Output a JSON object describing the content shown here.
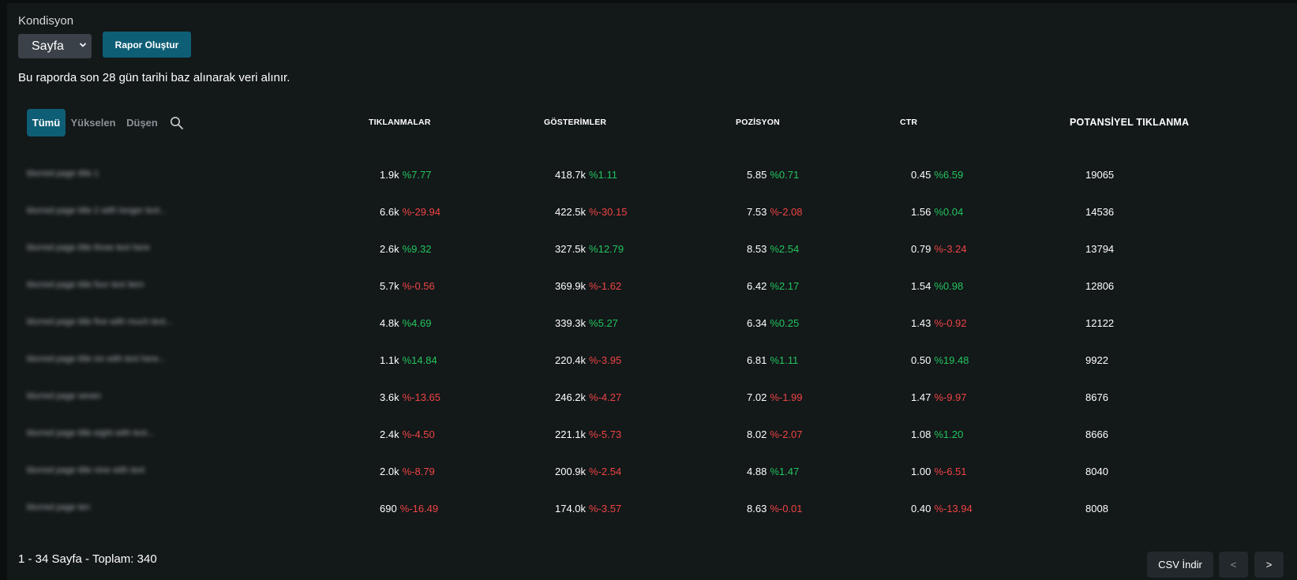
{
  "filter": {
    "label": "Kondisyon",
    "select_value": "Sayfa",
    "report_button": "Rapor Oluştur"
  },
  "info_text": "Bu raporda son 28 gün tarihi baz alınarak veri alınır.",
  "tabs": [
    {
      "label": "Tümü",
      "active": true
    },
    {
      "label": "Yükselen",
      "active": false
    },
    {
      "label": "Düşen",
      "active": false
    }
  ],
  "columns": {
    "clicks": "TIKLANMALAR",
    "impressions": "GÖSTERİMLER",
    "position": "POZİSYON",
    "ctr": "CTR",
    "potential": "POTANSİYEL TIKLANMA"
  },
  "rows": [
    {
      "label": "blurred page title 1",
      "clicks": "1.9k",
      "clicks_delta": "%7.77",
      "clicks_trend": "up",
      "impressions": "418.7k",
      "impressions_delta": "%1.11",
      "impressions_trend": "up",
      "position": "5.85",
      "position_delta": "%0.71",
      "position_trend": "up",
      "ctr": "0.45",
      "ctr_delta": "%6.59",
      "ctr_trend": "up",
      "potential": "19065"
    },
    {
      "label": "blurred page title 2 with longer text...",
      "clicks": "6.6k",
      "clicks_delta": "%-29.94",
      "clicks_trend": "down",
      "impressions": "422.5k",
      "impressions_delta": "%-30.15",
      "impressions_trend": "down",
      "position": "7.53",
      "position_delta": "%-2.08",
      "position_trend": "down",
      "ctr": "1.56",
      "ctr_delta": "%0.04",
      "ctr_trend": "up",
      "potential": "14536"
    },
    {
      "label": "blurred page title three text here",
      "clicks": "2.6k",
      "clicks_delta": "%9.32",
      "clicks_trend": "up",
      "impressions": "327.5k",
      "impressions_delta": "%12.79",
      "impressions_trend": "up",
      "position": "8.53",
      "position_delta": "%2.54",
      "position_trend": "up",
      "ctr": "0.79",
      "ctr_delta": "%-3.24",
      "ctr_trend": "down",
      "potential": "13794"
    },
    {
      "label": "blurred page title four text item",
      "clicks": "5.7k",
      "clicks_delta": "%-0.56",
      "clicks_trend": "down",
      "impressions": "369.9k",
      "impressions_delta": "%-1.62",
      "impressions_trend": "down",
      "position": "6.42",
      "position_delta": "%2.17",
      "position_trend": "up",
      "ctr": "1.54",
      "ctr_delta": "%0.98",
      "ctr_trend": "up",
      "potential": "12806"
    },
    {
      "label": "blurred page title five with much text...",
      "clicks": "4.8k",
      "clicks_delta": "%4.69",
      "clicks_trend": "up",
      "impressions": "339.3k",
      "impressions_delta": "%5.27",
      "impressions_trend": "up",
      "position": "6.34",
      "position_delta": "%0.25",
      "position_trend": "up",
      "ctr": "1.43",
      "ctr_delta": "%-0.92",
      "ctr_trend": "down",
      "potential": "12122"
    },
    {
      "label": "blurred page title six with text here...",
      "clicks": "1.1k",
      "clicks_delta": "%14.84",
      "clicks_trend": "up",
      "impressions": "220.4k",
      "impressions_delta": "%-3.95",
      "impressions_trend": "down",
      "position": "6.81",
      "position_delta": "%1.11",
      "position_trend": "up",
      "ctr": "0.50",
      "ctr_delta": "%19.48",
      "ctr_trend": "up",
      "potential": "9922"
    },
    {
      "label": "blurred page seven",
      "clicks": "3.6k",
      "clicks_delta": "%-13.65",
      "clicks_trend": "down",
      "impressions": "246.2k",
      "impressions_delta": "%-4.27",
      "impressions_trend": "down",
      "position": "7.02",
      "position_delta": "%-1.99",
      "position_trend": "down",
      "ctr": "1.47",
      "ctr_delta": "%-9.97",
      "ctr_trend": "down",
      "potential": "8676"
    },
    {
      "label": "blurred page title eight with text...",
      "clicks": "2.4k",
      "clicks_delta": "%-4.50",
      "clicks_trend": "down",
      "impressions": "221.1k",
      "impressions_delta": "%-5.73",
      "impressions_trend": "down",
      "position": "8.02",
      "position_delta": "%-2.07",
      "position_trend": "down",
      "ctr": "1.08",
      "ctr_delta": "%1.20",
      "ctr_trend": "up",
      "potential": "8666"
    },
    {
      "label": "blurred page title nine with text",
      "clicks": "2.0k",
      "clicks_delta": "%-8.79",
      "clicks_trend": "down",
      "impressions": "200.9k",
      "impressions_delta": "%-2.54",
      "impressions_trend": "down",
      "position": "4.88",
      "position_delta": "%1.47",
      "position_trend": "up",
      "ctr": "1.00",
      "ctr_delta": "%-6.51",
      "ctr_trend": "down",
      "potential": "8040"
    },
    {
      "label": "blurred page ten",
      "clicks": "690",
      "clicks_delta": "%-16.49",
      "clicks_trend": "down",
      "impressions": "174.0k",
      "impressions_delta": "%-3.57",
      "impressions_trend": "down",
      "position": "8.63",
      "position_delta": "%-0.01",
      "position_trend": "down",
      "ctr": "0.40",
      "ctr_delta": "%-13.94",
      "ctr_trend": "down",
      "potential": "8008"
    }
  ],
  "footer": {
    "pagination_text": "1 - 34 Sayfa - Toplam: 340",
    "csv_button": "CSV İndir",
    "prev_button": "<",
    "next_button": ">"
  },
  "colors": {
    "accent": "#0e5e75",
    "up": "#22c55e",
    "down": "#ef4444",
    "background": "#131819"
  },
  "icons": {
    "search": "search-icon",
    "select_chevron": "chevron-down-icon"
  }
}
